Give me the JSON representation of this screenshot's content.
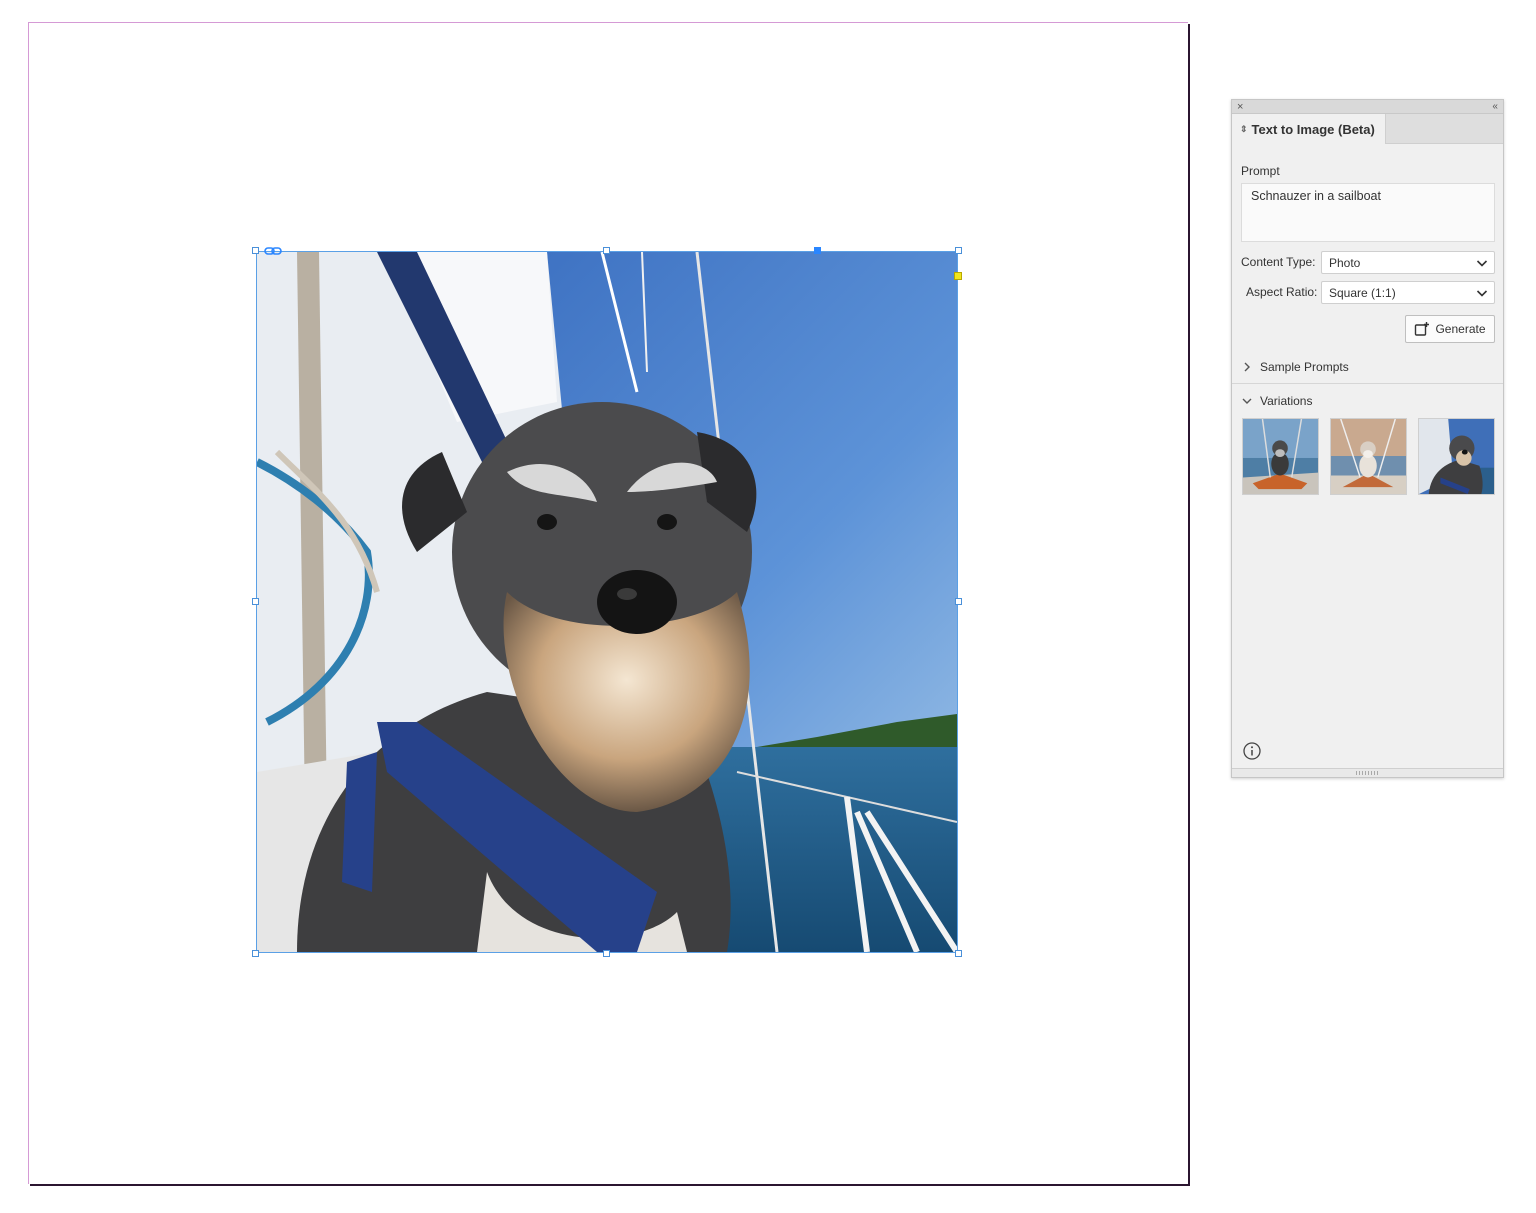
{
  "document": {
    "image_description_icon": "link-icon"
  },
  "panel": {
    "close_glyph": "×",
    "collapse_glyph": "‹‹",
    "tab_title": "Text to Image (Beta)",
    "prompt_label": "Prompt",
    "prompt_value": "Schnauzer in a sailboat",
    "content_type_label": "Content Type:",
    "content_type_value": "Photo",
    "aspect_ratio_label": "Aspect Ratio:",
    "aspect_ratio_value": "Square (1:1)",
    "generate_label": "Generate",
    "sample_prompts_label": "Sample Prompts",
    "variations_label": "Variations",
    "variations": [
      {
        "icon": "variation-thumbnail"
      },
      {
        "icon": "variation-thumbnail"
      },
      {
        "icon": "variation-thumbnail"
      }
    ],
    "info_icon": "info-icon"
  },
  "colors": {
    "selection": "#4a90d9",
    "page_border": "#d59ad5",
    "panel_bg": "#f0f0f0"
  }
}
